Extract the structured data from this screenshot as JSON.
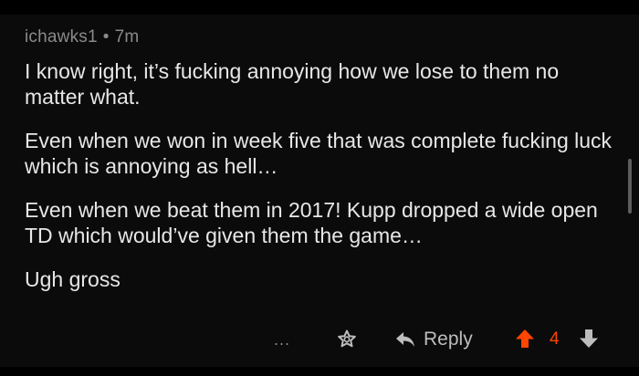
{
  "comment": {
    "username": "ichawks1",
    "separator": "•",
    "age": "7m",
    "paragraphs": [
      "I know right, it’s fucking annoying how we lose to them no matter what.",
      "Even when we won in week five that was complete fucking luck which is annoying as hell…",
      "Even when we beat them in 2017! Kupp dropped a wide open TD which would’ve given them the game…",
      "Ugh gross"
    ]
  },
  "actions": {
    "more_label": "...",
    "reply_label": "Reply",
    "score": "4"
  },
  "colors": {
    "background": "#000000",
    "card": "#0b0b0b",
    "text": "#e7e7e7",
    "meta": "#8a8a8a",
    "upvote": "#ff4500"
  },
  "icons": [
    "award-icon",
    "reply-arrow-icon",
    "upvote-arrow-icon",
    "downvote-arrow-icon"
  ]
}
